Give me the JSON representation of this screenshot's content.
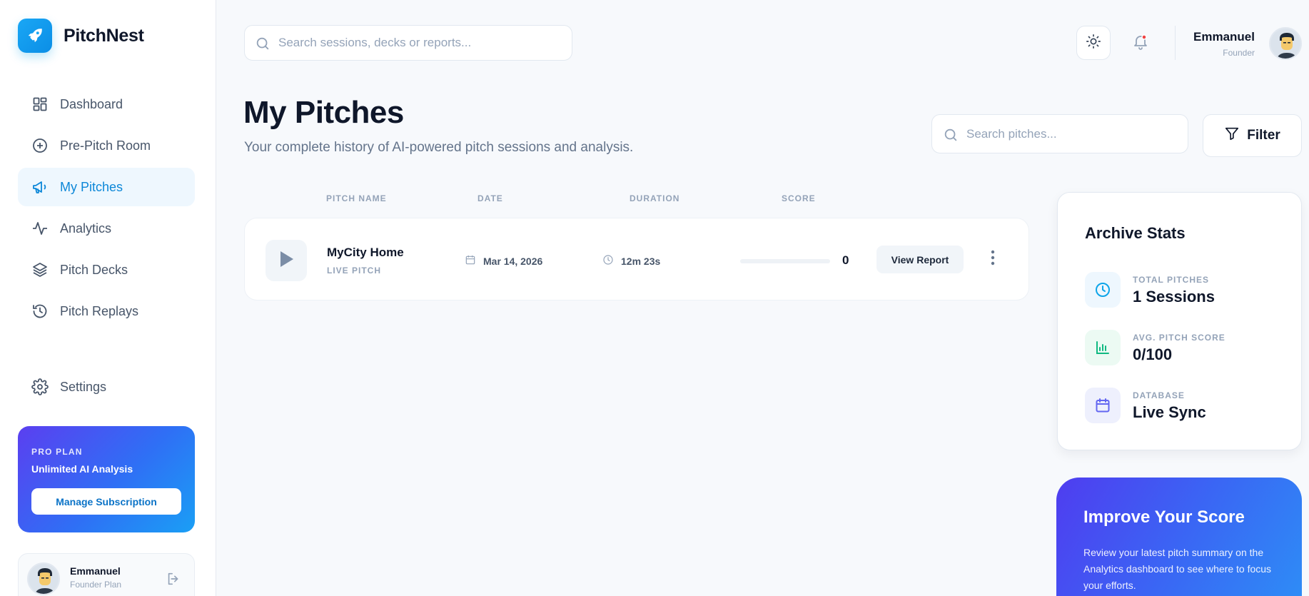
{
  "brand": {
    "name": "PitchNest"
  },
  "nav": {
    "items": [
      {
        "label": "Dashboard",
        "icon": "dashboard-icon"
      },
      {
        "label": "Pre-Pitch Room",
        "icon": "plus-circle-icon"
      },
      {
        "label": "My Pitches",
        "icon": "megaphone-icon",
        "active": true
      },
      {
        "label": "Analytics",
        "icon": "activity-icon"
      },
      {
        "label": "Pitch Decks",
        "icon": "layers-icon"
      },
      {
        "label": "Pitch Replays",
        "icon": "history-icon"
      }
    ],
    "settings_label": "Settings"
  },
  "pro_plan": {
    "tag": "PRO PLAN",
    "title": "Unlimited AI Analysis",
    "button": "Manage Subscription"
  },
  "sidebar_user": {
    "name": "Emmanuel",
    "plan": "Founder Plan"
  },
  "topbar": {
    "search_placeholder": "Search sessions, decks or reports...",
    "user_name": "Emmanuel",
    "user_role": "Founder"
  },
  "header": {
    "title": "My Pitches",
    "subtitle": "Your complete history of AI-powered pitch sessions and analysis.",
    "search_placeholder": "Search pitches...",
    "filter_label": "Filter"
  },
  "table": {
    "columns": [
      "PITCH NAME",
      "DATE",
      "DURATION",
      "SCORE"
    ],
    "rows": [
      {
        "name": "MyCity Home",
        "type": "LIVE PITCH",
        "date": "Mar 14, 2026",
        "duration": "12m 23s",
        "score": "0",
        "score_fraction": 0,
        "action": "View Report"
      }
    ]
  },
  "archive_stats": {
    "title": "Archive Stats",
    "items": [
      {
        "label": "TOTAL PITCHES",
        "value": "1 Sessions",
        "icon": "clock-icon",
        "color": "#0ea5e9"
      },
      {
        "label": "AVG. PITCH SCORE",
        "value": "0/100",
        "icon": "bar-chart-icon",
        "color": "#10b981"
      },
      {
        "label": "DATABASE",
        "value": "Live Sync",
        "icon": "calendar-icon",
        "color": "#6366f1"
      }
    ]
  },
  "improve": {
    "title": "Improve Your Score",
    "text": "Review your latest pitch summary on the Analytics dashboard to see where to focus your efforts."
  },
  "colors": {
    "accent": "#0ea5e9",
    "active_bg": "#eef7fe",
    "text": "#0f172a",
    "muted": "#94a3b8"
  }
}
